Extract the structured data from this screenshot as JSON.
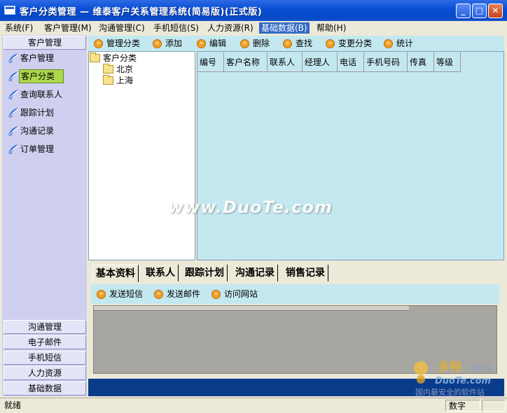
{
  "window": {
    "title": "客户分类管理  —  维泰客户关系管理系统(简易版)(正式版)"
  },
  "menu": [
    "系统(F)",
    "客户管理(M)",
    "沟通管理(C)",
    "手机短信(S)",
    "人力资源(R)",
    "基础数据(B)",
    "帮助(H)"
  ],
  "leftnav": {
    "header": "客户管理",
    "items": [
      "客户管理",
      "客户分类",
      "查询联系人",
      "跟踪计划",
      "沟通记录",
      "订单管理"
    ],
    "selected": "客户分类",
    "sections": [
      "沟通管理",
      "电子邮件",
      "手机短信",
      "人力资源",
      "基础数据"
    ]
  },
  "toolbar": [
    "管理分类",
    "添加",
    "编辑",
    "删除",
    "查找",
    "变更分类",
    "统计"
  ],
  "tree": {
    "root": "客户分类",
    "children": [
      "北京",
      "上海"
    ]
  },
  "grid": {
    "columns": [
      "编号",
      "客户名称",
      "联系人",
      "经理人",
      "电话",
      "手机号码",
      "传真",
      "等级"
    ]
  },
  "detail_tabs": [
    "基本资料",
    "联系人",
    "跟踪计划",
    "沟通记录",
    "销售记录"
  ],
  "detail_toolbar": [
    "发送短信",
    "发送邮件",
    "访问网站"
  ],
  "status": {
    "left": "就绪",
    "right": "数字"
  },
  "watermark": {
    "text": "www.DuoTe.com",
    "logo_cn": "多特软件站",
    "logo_en": "DuoTe.com",
    "logo_tagline": "国内最安全的软件站"
  },
  "colors": {
    "titlebar": "#0a4fd6",
    "panel": "#c4e8f0",
    "nav": "#cfcfef",
    "selected": "#acd84c",
    "bottom": "#0a3c8c"
  }
}
